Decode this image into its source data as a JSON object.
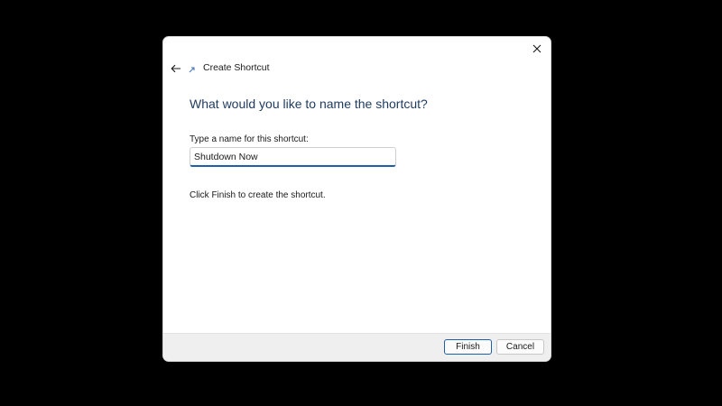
{
  "window": {
    "title": "Create Shortcut",
    "title_icon": "shortcut-arrow-icon",
    "close_icon": "close-icon",
    "back_icon": "back-arrow-icon"
  },
  "main": {
    "heading": "What would you like to name the shortcut?",
    "field_label": "Type a name for this shortcut:",
    "name_value": "Shutdown Now",
    "hint": "Click Finish to create the shortcut."
  },
  "footer": {
    "finish_label": "Finish",
    "cancel_label": "Cancel"
  },
  "colors": {
    "backdrop": "#000000",
    "heading": "#1e3a5f",
    "accent": "#1f5fa8",
    "footer_bg": "#efefef"
  }
}
